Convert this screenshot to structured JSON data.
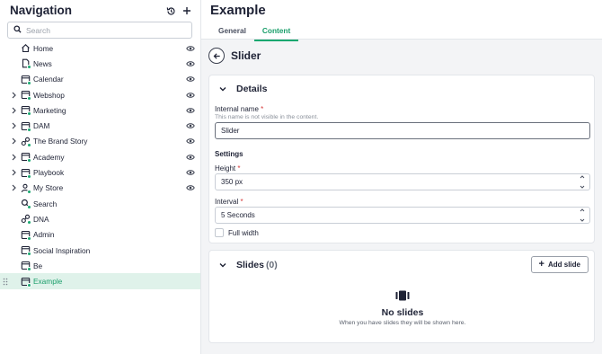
{
  "navigation": {
    "title": "Navigation",
    "search_placeholder": "Search",
    "items": [
      {
        "label": "Home",
        "icon": "home-icon",
        "expandable": false
      },
      {
        "label": "News",
        "icon": "page-icon",
        "expandable": false
      },
      {
        "label": "Calendar",
        "icon": "window-icon",
        "expandable": false
      },
      {
        "label": "Webshop",
        "icon": "window-icon",
        "expandable": true
      },
      {
        "label": "Marketing",
        "icon": "window-icon",
        "expandable": true
      },
      {
        "label": "DAM",
        "icon": "window-icon",
        "expandable": true
      },
      {
        "label": "The Brand Story",
        "icon": "link-icon",
        "expandable": true
      },
      {
        "label": "Academy",
        "icon": "window-icon",
        "expandable": true
      },
      {
        "label": "Playbook",
        "icon": "window-icon",
        "expandable": true
      },
      {
        "label": "My Store",
        "icon": "user-icon",
        "expandable": true
      },
      {
        "label": "Search",
        "icon": "search-icon",
        "expandable": false
      },
      {
        "label": "DNA",
        "icon": "link-icon",
        "expandable": false
      },
      {
        "label": "Admin",
        "icon": "window-icon",
        "expandable": false
      },
      {
        "label": "Social Inspiration",
        "icon": "window-icon",
        "expandable": false
      },
      {
        "label": "Be",
        "icon": "window-icon",
        "expandable": false
      },
      {
        "label": "Example",
        "icon": "window-icon",
        "expandable": false,
        "active": true
      }
    ]
  },
  "header": {
    "title": "Example",
    "tabs": [
      {
        "label": "General",
        "active": false
      },
      {
        "label": "Content",
        "active": true
      }
    ]
  },
  "editor": {
    "title": "Slider",
    "details": {
      "title": "Details",
      "internal_name_label": "Internal name",
      "required_mark": "*",
      "internal_name_help": "This name is not visible in the content.",
      "internal_name_value": "Slider",
      "settings_label": "Settings",
      "height_label": "Height",
      "height_value": "350 px",
      "interval_label": "Interval",
      "interval_value": "5 Seconds",
      "full_width_label": "Full width",
      "full_width_checked": false
    },
    "slides": {
      "title": "Slides",
      "count": "(0)",
      "add_label": "Add slide",
      "empty_title": "No slides",
      "empty_text": "When you have slides they will be shown here."
    }
  },
  "colors": {
    "accent": "#1aa870",
    "active_bg": "#dff2ea",
    "required": "#d63b3b"
  }
}
